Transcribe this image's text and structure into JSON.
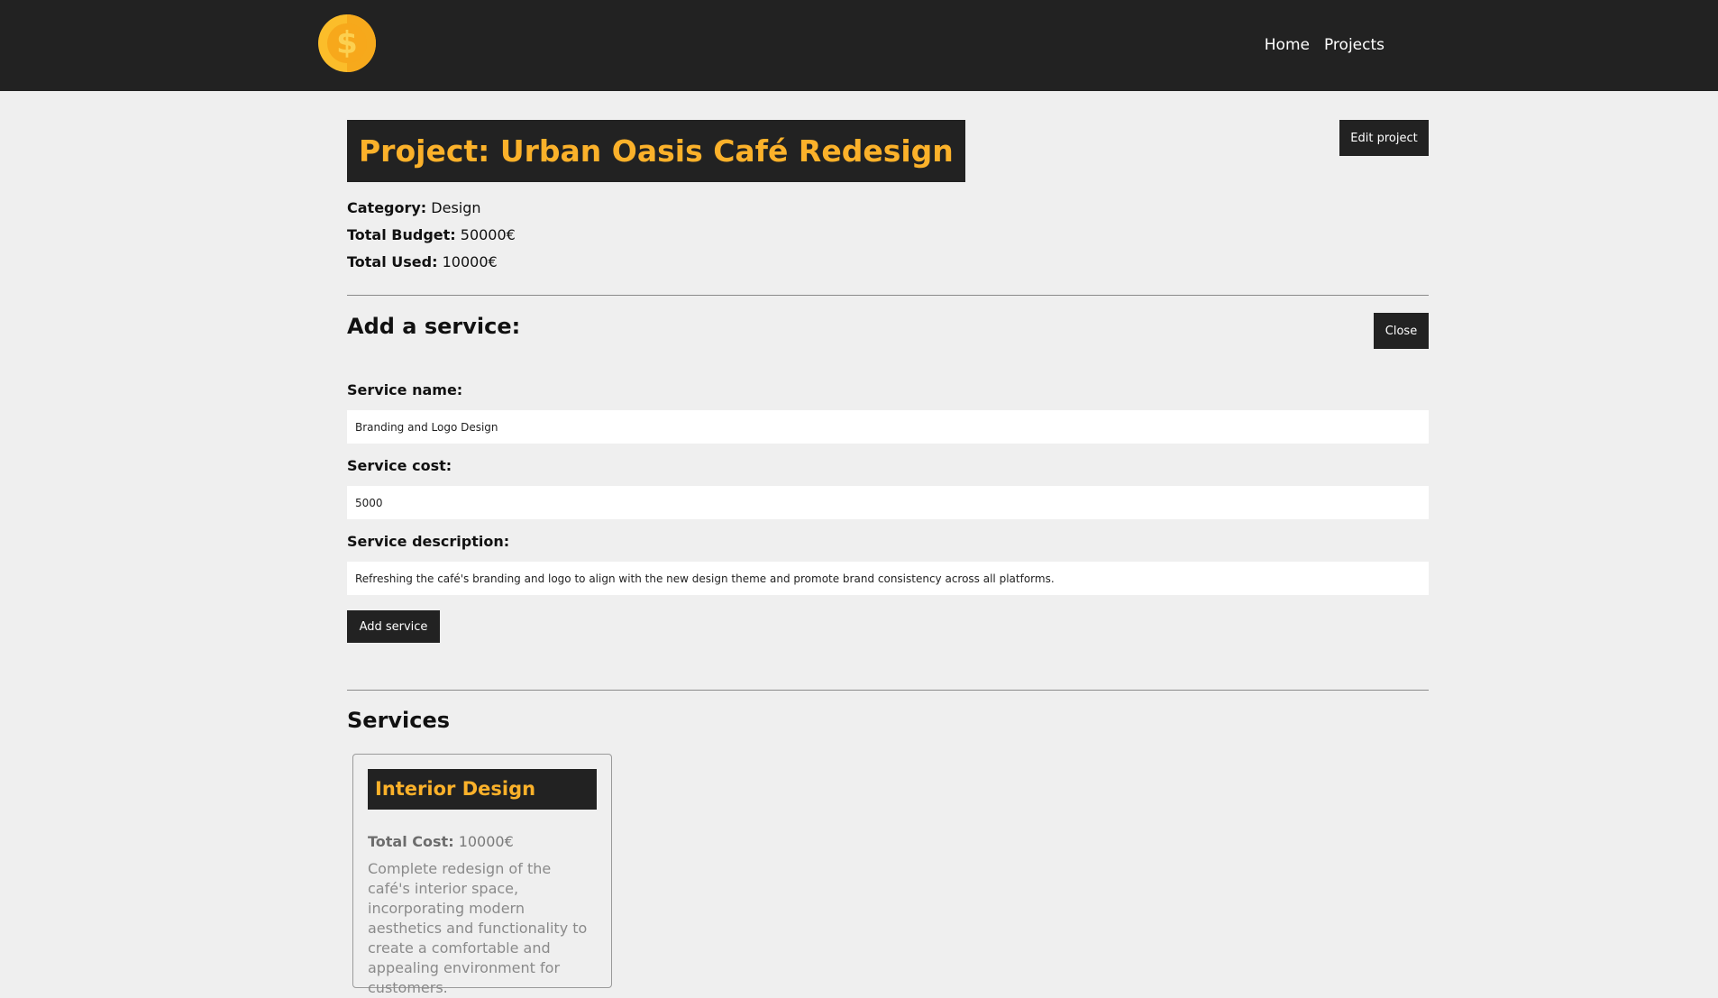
{
  "nav": {
    "home": "Home",
    "projects": "Projects"
  },
  "project": {
    "title": "Project: Urban Oasis Café Redesign",
    "edit_label": "Edit project",
    "category_label": "Category:",
    "category_value": "Design",
    "budget_label": "Total Budget:",
    "budget_value": "50000€",
    "used_label": "Total Used:",
    "used_value": "10000€"
  },
  "add_service": {
    "heading": "Add a service:",
    "close_label": "Close",
    "name_label": "Service name:",
    "name_value": "Branding and Logo Design",
    "cost_label": "Service cost:",
    "cost_value": "5000",
    "desc_label": "Service description:",
    "desc_value": "Refreshing the café's branding and logo to align with the new design theme and promote brand consistency across all platforms.",
    "submit_label": "Add service"
  },
  "services": {
    "heading": "Services",
    "items": [
      {
        "name": "Interior Design",
        "cost_label": "Total Cost:",
        "cost_value": "10000€",
        "description": "Complete redesign of the café's interior space, incorporating modern aesthetics and functionality to create a comfortable and appealing environment for customers."
      }
    ]
  },
  "colors": {
    "header_bg": "#222222",
    "accent": "#fbb12a",
    "page_bg": "#efefef"
  }
}
